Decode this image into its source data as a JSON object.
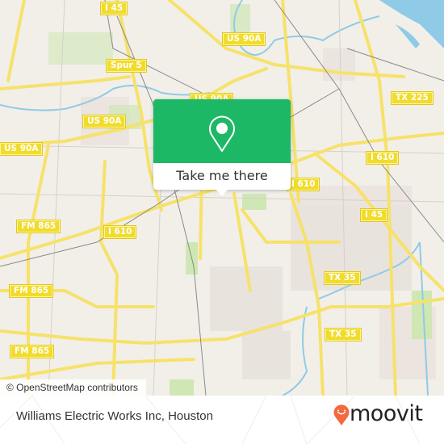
{
  "map": {
    "colors": {
      "land": "#f2efe9",
      "road": "#f6e26a",
      "water": "#8fcbe6",
      "park": "#cfe7b5",
      "accent": "#1db866",
      "brand": "#f26a3d"
    },
    "shields": [
      {
        "id": "i45-top",
        "label": "I 45"
      },
      {
        "id": "us90a-top",
        "label": "US 90A"
      },
      {
        "id": "spur5",
        "label": "Spur 5"
      },
      {
        "id": "us90a-card",
        "label": "US 90A"
      },
      {
        "id": "us90a-mid",
        "label": "US 90A"
      },
      {
        "id": "us90a-left",
        "label": "US 90A"
      },
      {
        "id": "tx225",
        "label": "TX 225"
      },
      {
        "id": "i610-right",
        "label": "I 610"
      },
      {
        "id": "i610-card",
        "label": "I 610"
      },
      {
        "id": "i45-right",
        "label": "I 45"
      },
      {
        "id": "fm865-1",
        "label": "FM 865"
      },
      {
        "id": "i610-left",
        "label": "I 610"
      },
      {
        "id": "fm865-2",
        "label": "FM 865"
      },
      {
        "id": "tx35-1",
        "label": "TX 35"
      },
      {
        "id": "tx35-2",
        "label": "TX 35"
      },
      {
        "id": "fm865-3",
        "label": "FM 865"
      }
    ],
    "attribution": "© OpenStreetMap contributors"
  },
  "card": {
    "icon": "location-pin-icon",
    "button_label": "Take me there"
  },
  "footer": {
    "place_name": "Williams Electric Works Inc, Houston",
    "brand": "moovit",
    "brand_icon": "moovit-smile-pin-icon"
  }
}
